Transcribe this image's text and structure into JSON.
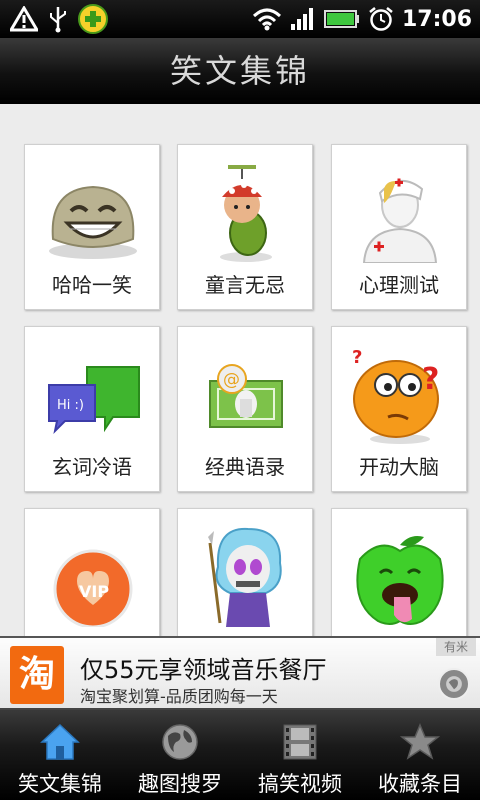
{
  "status_bar": {
    "time": "17:06",
    "icons": [
      "warning-icon",
      "usb-icon",
      "app-360-icon",
      "wifi-icon",
      "signal-icon",
      "battery-icon",
      "alarm-icon"
    ]
  },
  "header": {
    "title": "笑文集锦"
  },
  "grid": {
    "items": [
      {
        "label": "哈哈一笑",
        "icon": "laughing-blob-icon"
      },
      {
        "label": "童言无忌",
        "icon": "child-propeller-cap-icon"
      },
      {
        "label": "心理测试",
        "icon": "nurse-icon"
      },
      {
        "label": "玄词冷语",
        "icon": "chat-bubbles-icon"
      },
      {
        "label": "经典语录",
        "icon": "money-mail-icon"
      },
      {
        "label": "开动大脑",
        "icon": "question-smiley-icon"
      },
      {
        "label": "",
        "icon": "vip-heart-icon"
      },
      {
        "label": "",
        "icon": "skull-doll-icon"
      },
      {
        "label": "",
        "icon": "green-apple-icon"
      }
    ]
  },
  "ad": {
    "logo_text": "淘",
    "title": "仅55元享领域音乐餐厅",
    "subtitle": "淘宝聚划算-品质团购每一天",
    "tag": "有米"
  },
  "tabs": [
    {
      "label": "笑文集锦",
      "icon": "home-icon",
      "active": true
    },
    {
      "label": "趣图搜罗",
      "icon": "globe-icon",
      "active": false
    },
    {
      "label": "搞笑视频",
      "icon": "film-icon",
      "active": false
    },
    {
      "label": "收藏条目",
      "icon": "star-icon",
      "active": false
    }
  ],
  "colors": {
    "accent_tab": "#4aa3f0",
    "ad_logo": "#f26a10",
    "battery": "#3fc73f"
  }
}
